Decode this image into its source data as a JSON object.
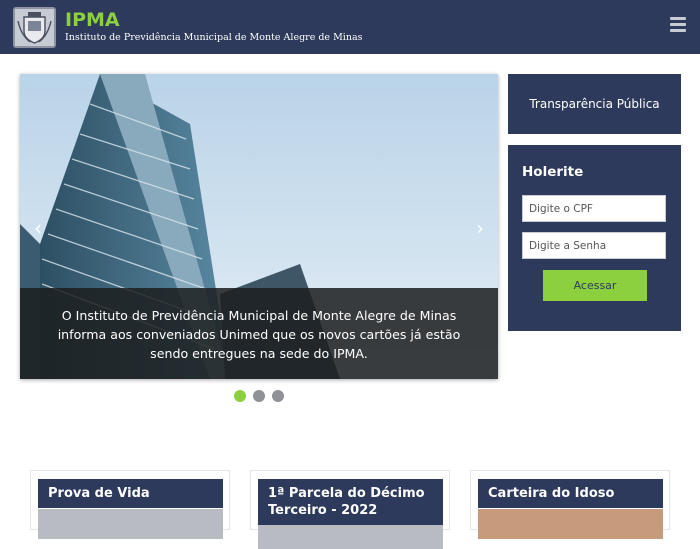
{
  "header": {
    "brand": "IPMA",
    "subtitle": "Instituto de Previdência Municipal de Monte Alegre de Minas"
  },
  "carousel": {
    "prev_glyph": "‹",
    "next_glyph": "›",
    "caption_lines": [
      "O Instituto de Previdência Municipal de Monte Alegre de Minas",
      "informa aos conveniados Unimed que os novos cartões já estão",
      "sendo entregues na sede do IPMA."
    ],
    "slides": 3,
    "active_slide": 1
  },
  "sidebar": {
    "transparencia": "Transparência Pública",
    "holerite": {
      "title": "Holerite",
      "cpf_placeholder": "Digite o CPF",
      "password_placeholder": "Digite a Senha",
      "submit": "Acessar"
    }
  },
  "cards": [
    {
      "title": "Prova de Vida"
    },
    {
      "title": "1ª Parcela do Décimo Terceiro - 2022"
    },
    {
      "title": "Carteira do Idoso"
    }
  ],
  "colors": {
    "navy": "#2e3a5c",
    "accent_green": "#8ccf3f"
  },
  "icons": {
    "logo": "municipal-coat-of-arms-icon",
    "menu": "hamburger-menu-icon"
  }
}
